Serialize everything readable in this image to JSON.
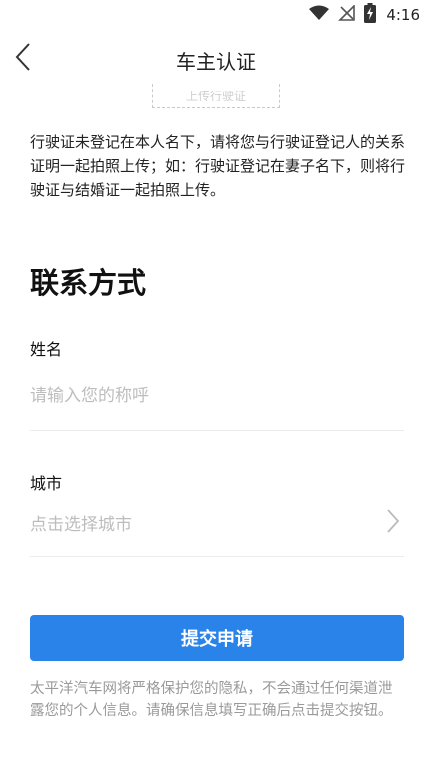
{
  "status_bar": {
    "time": "4:16",
    "icons": [
      "wifi-icon",
      "no-signal-icon",
      "battery-charging-icon"
    ]
  },
  "header": {
    "title": "车主认证",
    "back_icon": "chevron-left-icon"
  },
  "upload": {
    "label": "上传行驶证"
  },
  "notice": "行驶证未登记在本人名下，请将您与行驶证登记人的关系证明一起拍照上传；如：行驶证登记在妻子名下，则将行驶证与结婚证一起拍照上传。",
  "contact": {
    "title": "联系方式",
    "name_label": "姓名",
    "name_placeholder": "请输入您的称呼",
    "city_label": "城市",
    "city_placeholder": "点击选择城市"
  },
  "submit_label": "提交申请",
  "footer_note": "太平洋汽车网将严格保护您的隐私，不会通过任何渠道泄露您的个人信息。请确保信息填写正确后点击提交按钮。",
  "colors": {
    "accent": "#2a83e8",
    "placeholder": "#bdbdbd",
    "footer_text": "#9a9a9a"
  }
}
